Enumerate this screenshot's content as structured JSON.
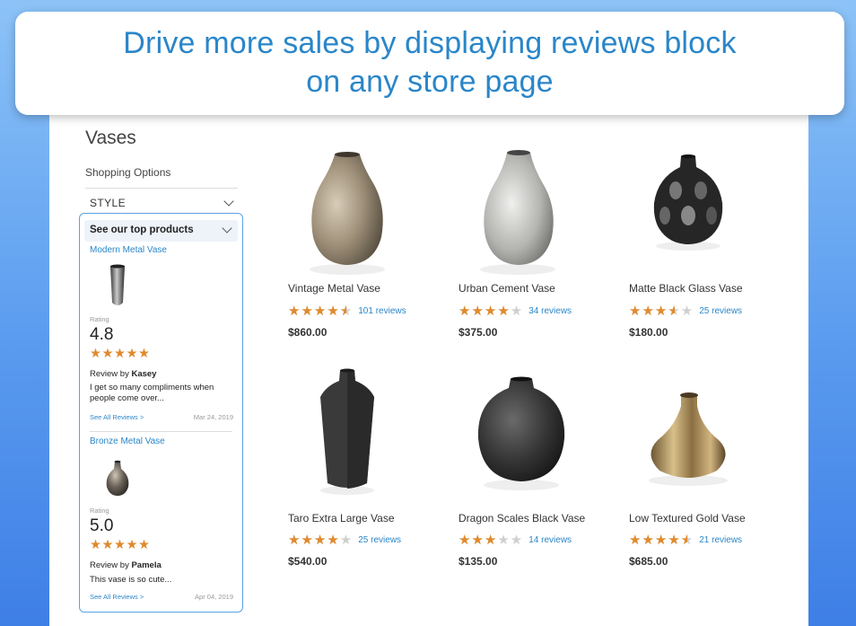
{
  "banner": {
    "line1": "Drive more sales by displaying reviews block",
    "line2": "on any store page"
  },
  "page": {
    "title": "Vases",
    "shopping_options": "Shopping Options",
    "style_filter": "STYLE"
  },
  "widget": {
    "heading": "See our top products",
    "items": [
      {
        "product": "Modern Metal Vase",
        "rating_label": "Rating",
        "rating": "4.8",
        "stars": "★★★★★",
        "review_by": "Review by",
        "reviewer": "Kasey",
        "text": "I get so many compliments when people come over...",
        "link": "See All Reviews >",
        "date": "Mar 24, 2019"
      },
      {
        "product": "Bronze Metal Vase",
        "rating_label": "Rating",
        "rating": "5.0",
        "stars": "★★★★★",
        "review_by": "Review by",
        "reviewer": "Pamela",
        "text": "This vase is so cute...",
        "link": "See All Reviews >",
        "date": "Apr 04, 2019"
      }
    ]
  },
  "products": [
    {
      "name": "Vintage Metal Vase",
      "rating": 4.5,
      "reviews": "101 reviews",
      "price": "$860.00"
    },
    {
      "name": "Urban Cement Vase",
      "rating": 4,
      "reviews": "34 reviews",
      "price": "$375.00"
    },
    {
      "name": "Matte Black Glass Vase",
      "rating": 3.5,
      "reviews": "25 reviews",
      "price": "$180.00"
    },
    {
      "name": "Taro Extra Large Vase",
      "rating": 4,
      "reviews": "25 reviews",
      "price": "$540.00"
    },
    {
      "name": "Dragon Scales Black Vase",
      "rating": 3,
      "reviews": "14 reviews",
      "price": "$135.00"
    },
    {
      "name": "Low Textured Gold Vase",
      "rating": 4.5,
      "reviews": "21 reviews",
      "price": "$685.00"
    }
  ],
  "colors": {
    "accent": "#2a86c9",
    "star": "#e08a2c",
    "star_empty": "#cfcfcf"
  }
}
